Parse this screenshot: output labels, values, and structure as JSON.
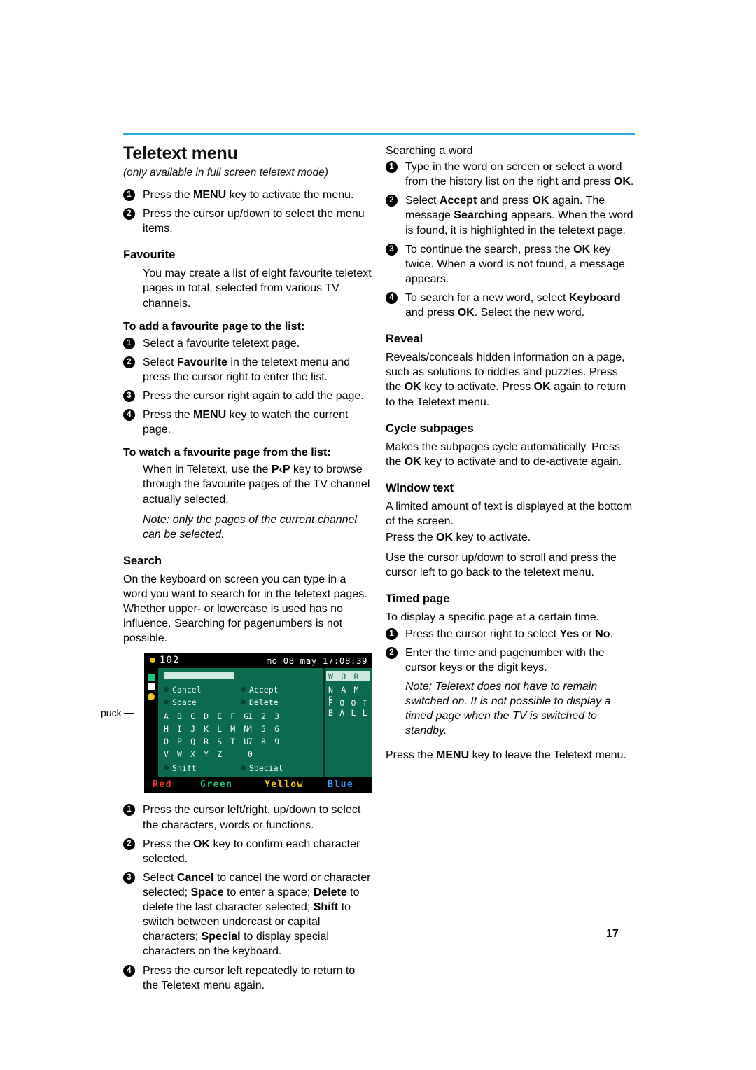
{
  "page": {
    "number": "17"
  },
  "left": {
    "title": "Teletext menu",
    "subtitle": "(only available in full screen teletext mode)",
    "intro_steps": [
      "Press the MENU key to activate the menu.",
      "Press the cursor up/down to select the menu items."
    ],
    "favourite": {
      "heading": "Favourite",
      "body": "You may create a list of eight favourite teletext pages in total, selected from various TV channels.",
      "add_heading": "To add a favourite page to the list:",
      "add_steps": [
        "Select a favourite teletext page.",
        "Select Favourite in the teletext menu and press the cursor right to enter the list.",
        "Press the cursor right again to add the page.",
        "Press the MENU key to watch the current page."
      ],
      "watch_heading": "To watch a favourite page from the list:",
      "watch_body": "When in Teletext, use the P‹P key to browse through the favourite pages of the TV channel actually selected.",
      "note": "Note: only the pages of the current channel can be selected."
    },
    "search": {
      "heading": "Search",
      "body": "On the keyboard on screen you can type in a word you want to search for in the teletext pages. Whether upper- or lowercase is used has no influence. Searching for pagenumbers is not possible.",
      "steps": [
        "Press the cursor left/right, up/down to select the characters, words or functions.",
        "Press the OK key to confirm each character selected.",
        "Select Cancel to cancel the word or character selected; Space to enter a space; Delete to delete the last character selected; Shift to switch between undercast or capital characters; Special to display special characters on the keyboard.",
        "Press the cursor left repeatedly to return to the Teletext menu again."
      ]
    },
    "tv": {
      "page_label": "102",
      "clock": "mo 08 may 17:08:39",
      "callout": "puck",
      "buttons": [
        "Cancel",
        "Accept",
        "Space",
        "Delete",
        "Shift",
        "Special"
      ],
      "keyrows": [
        "A B C D E F G",
        "H I J K L M N",
        "O P Q R S T U",
        "V W X Y Z"
      ],
      "numrows": [
        "1 2 3",
        "4 5 6",
        "7 8 9",
        "0"
      ],
      "right_lines": [
        "W O R D",
        "N A M E",
        "F O O T B A L L"
      ],
      "colorkeys": [
        "Red",
        "Green",
        "Yellow",
        "Blue"
      ]
    }
  },
  "right": {
    "searching": {
      "heading": "Searching a word",
      "steps": [
        "Type in the word on screen or select a word from the history list on the right and press OK.",
        "Select Accept and press OK again. The message Searching appears. When the word is found, it is highlighted in the teletext page.",
        "To continue the search, press the OK key twice. When a word is not found, a message appears.",
        "To search for a new word, select Keyboard and press OK. Select the new word."
      ]
    },
    "reveal": {
      "heading": "Reveal",
      "body": "Reveals/conceals hidden information on a page, such as solutions to riddles and puzzles. Press the OK key to activate. Press OK again to return to the Teletext menu."
    },
    "cycle": {
      "heading": "Cycle subpages",
      "body": "Makes the subpages cycle automatically. Press the OK key to activate and to de-activate again."
    },
    "window": {
      "heading": "Window text",
      "body1": "A limited amount of text is displayed at the bottom of the screen.",
      "body2": "Press the OK key to activate.",
      "body3": "Use the cursor up/down to scroll and press the cursor left to go back to the teletext menu."
    },
    "timed": {
      "heading": "Timed page",
      "body": "To display a specific page at a certain time.",
      "steps": [
        "Press the cursor right to select Yes or No.",
        "Enter the time and pagenumber with the cursor keys or the digit keys."
      ],
      "note": "Note: Teletext does not have to remain switched on. It is not possible to display a timed page when the TV is switched to standby."
    },
    "closing": "Press the MENU key to leave the Teletext menu."
  }
}
